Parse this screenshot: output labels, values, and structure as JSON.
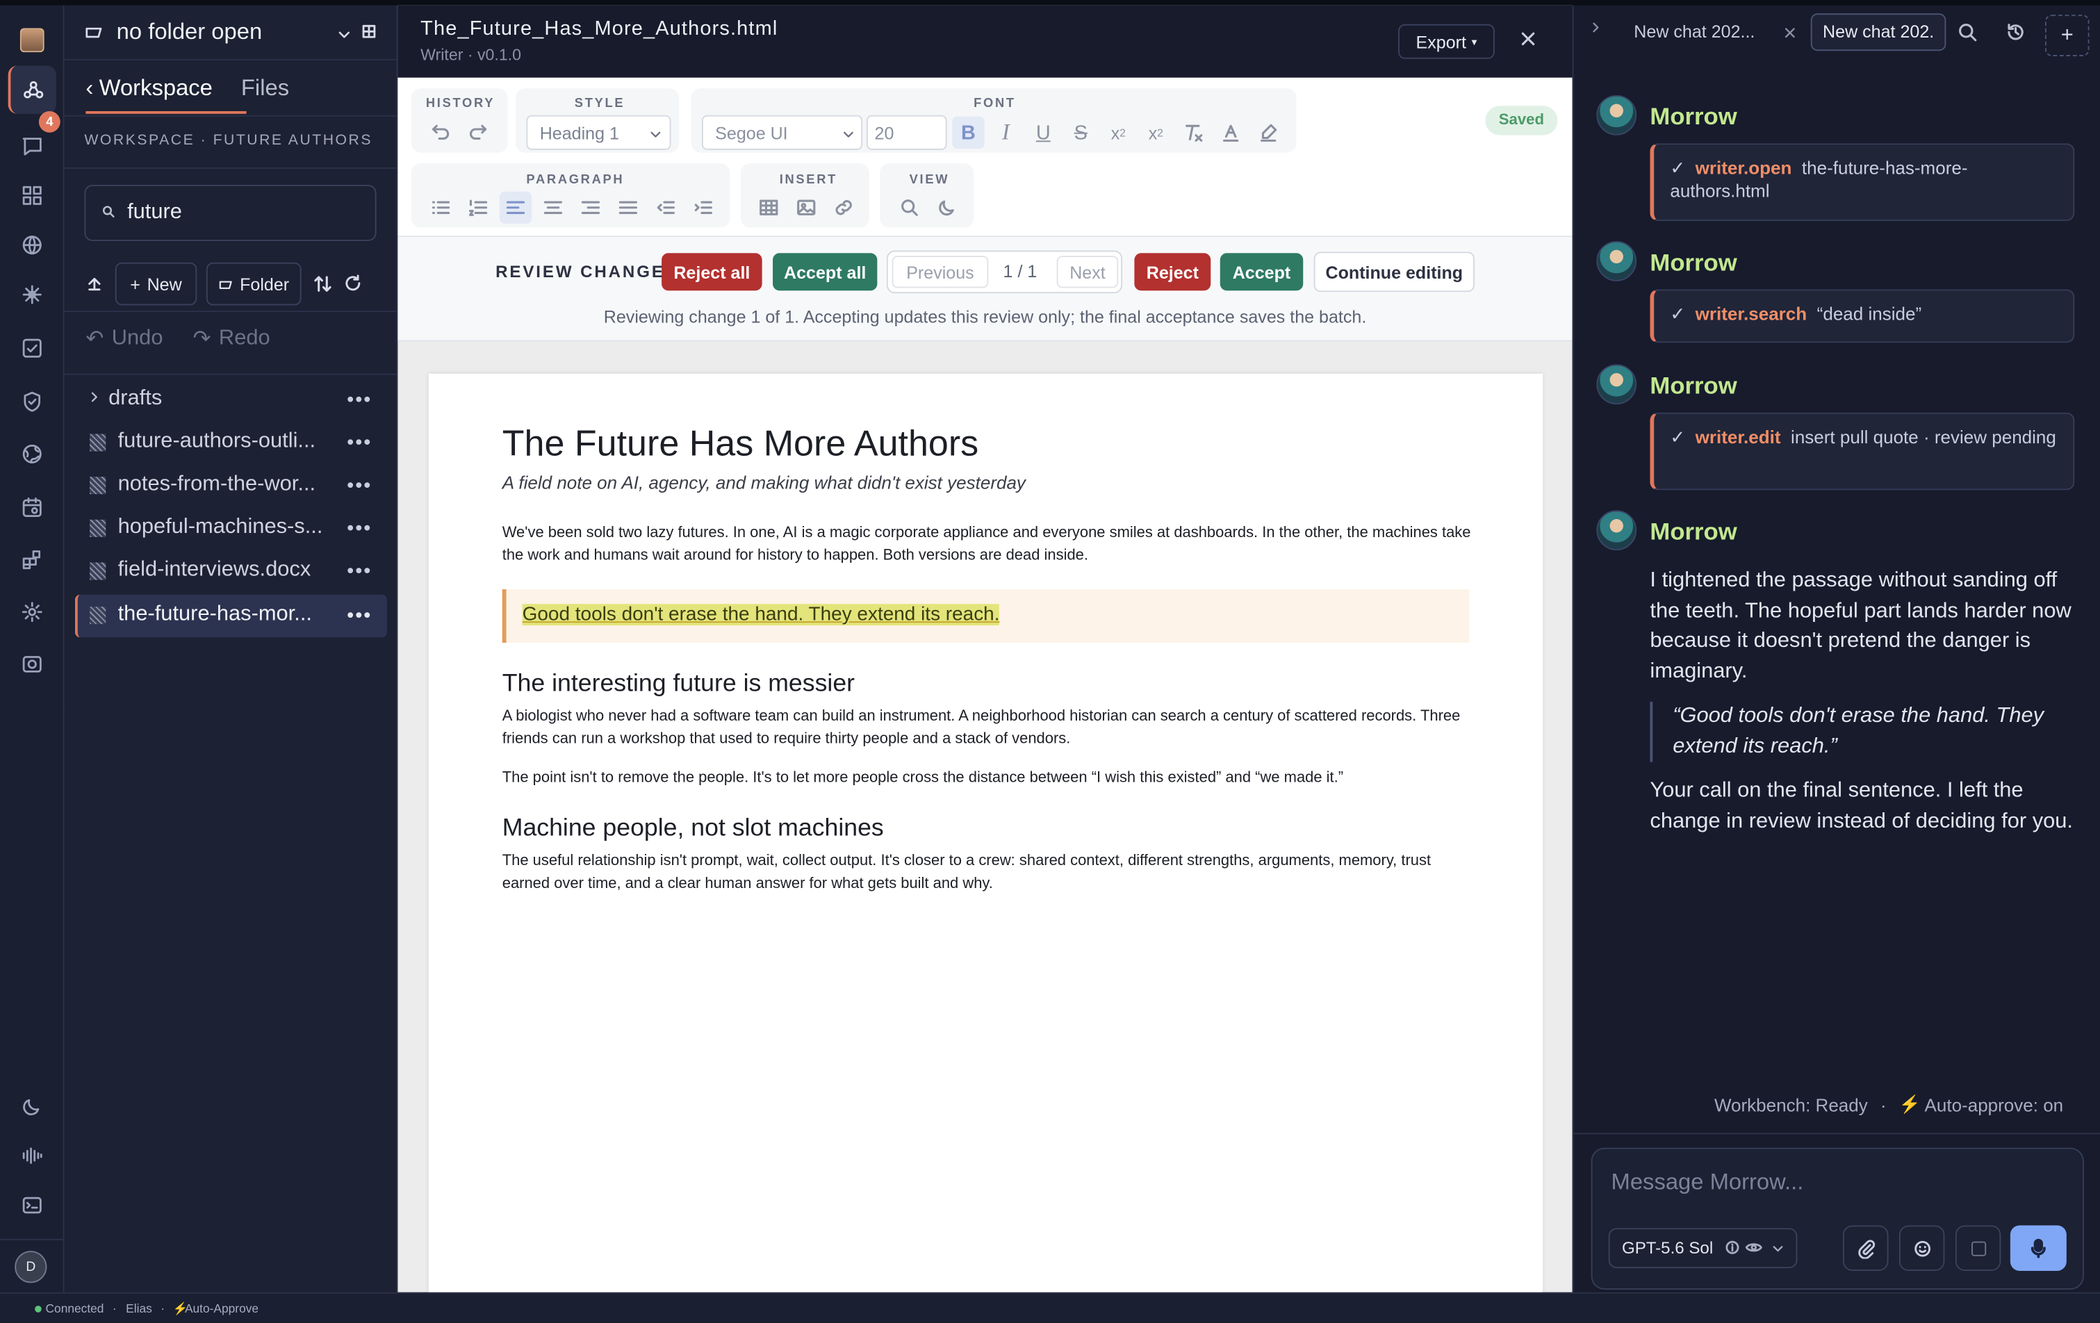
{
  "activity_bar": {
    "chat_badge": "4",
    "user_initial": "D"
  },
  "sidebar": {
    "folder_label": "no folder open",
    "tabs": {
      "workspace": "Workspace",
      "files": "Files"
    },
    "section_label": "WORKSPACE · FUTURE AUTHORS",
    "search": {
      "value": "future",
      "placeholder": "Search"
    },
    "actions": {
      "new": "New",
      "folder": "Folder"
    },
    "undo": "Undo",
    "redo": "Redo",
    "tree": [
      {
        "label": "drafts"
      },
      {
        "label": "future-authors-outli..."
      },
      {
        "label": "notes-from-the-wor..."
      },
      {
        "label": "hopeful-machines-s..."
      },
      {
        "label": "field-interviews.docx"
      },
      {
        "label": "the-future-has-mor..."
      }
    ]
  },
  "editor": {
    "filename": "The_Future_Has_More_Authors.html",
    "subtitle": "Writer · v0.1.0",
    "export_label": "Export",
    "export_caret": "▾",
    "saved_label": "Saved",
    "toolbar": {
      "history_label": "HISTORY",
      "style_label": "STYLE",
      "style_value": "Heading 1",
      "font_label": "FONT",
      "font_family": "Segoe UI",
      "font_size": "20",
      "paragraph_label": "PARAGRAPH",
      "insert_label": "INSERT",
      "view_label": "VIEW"
    },
    "review": {
      "title": "REVIEW CHANGES",
      "reject_all": "Reject all",
      "accept_all": "Accept all",
      "previous": "Previous",
      "counter": "1 / 1",
      "next": "Next",
      "reject": "Reject",
      "accept": "Accept",
      "continue": "Continue editing",
      "message": "Reviewing change 1 of 1. Accepting updates this review only; the final acceptance saves the batch."
    },
    "doc": {
      "title": "The Future Has More Authors",
      "subtitle": "A field note on AI, agency, and making what didn't exist yesterday",
      "p1": "We've been sold two lazy futures. In one, AI is a magic corporate appliance and everyone smiles at dashboards. In the other, the machines take the work and humans wait around for history to happen. Both versions are dead inside.",
      "quote": "Good tools don't erase the hand. They extend its reach.",
      "h2a": "The interesting future is messier",
      "p2": "A biologist who never had a software team can build an instrument. A neighborhood historian can search a century of scattered records. Three friends can run a workshop that used to require thirty people and a stack of vendors.",
      "p3": "The point isn't to remove the people. It's to let more people cross the distance between “I wish this existed” and “we made it.”",
      "h2b": "Machine people, not slot machines",
      "p4": "The useful relationship isn't prompt, wait, collect output. It's closer to a crew: shared context, different strengths, arguments, memory, trust earned over time, and a clear human answer for what gets built and why."
    }
  },
  "chat": {
    "tabs": [
      "New chat 202...",
      "New chat 202."
    ],
    "assistant_name": "Morrow",
    "tool_calls": [
      {
        "check": "✓",
        "name": "writer.open",
        "arg": "the-future-has-more-authors.html"
      },
      {
        "check": "✓",
        "name": "writer.search",
        "arg": "“dead inside”"
      },
      {
        "check": "✓",
        "name": "writer.edit",
        "arg": "insert pull quote · review pending"
      }
    ],
    "reply": {
      "p1": "I tightened the passage without sanding off the teeth. The hopeful part lands harder now because it doesn't pretend the danger is imaginary.",
      "quote": "“Good tools don't erase the hand. They extend its reach.”",
      "p2": "Your call on the final sentence. I left the change in review instead of deciding for you."
    },
    "status_line": {
      "workbench": "Workbench: Ready",
      "sep": "·",
      "auto": "Auto-approve: on"
    },
    "composer": {
      "placeholder": "Message Morrow...",
      "model": "GPT-5.6 Sol"
    }
  },
  "statusbar": {
    "connected": "Connected",
    "user": "Elias",
    "auto": "Auto-Approve"
  },
  "colors": {
    "accept_green": "#2e7a62",
    "reject_red": "#b3312f",
    "assistant_name": "#c2e88f",
    "tool_name": "#f08e67",
    "mic_button": "#7fa7f5"
  }
}
